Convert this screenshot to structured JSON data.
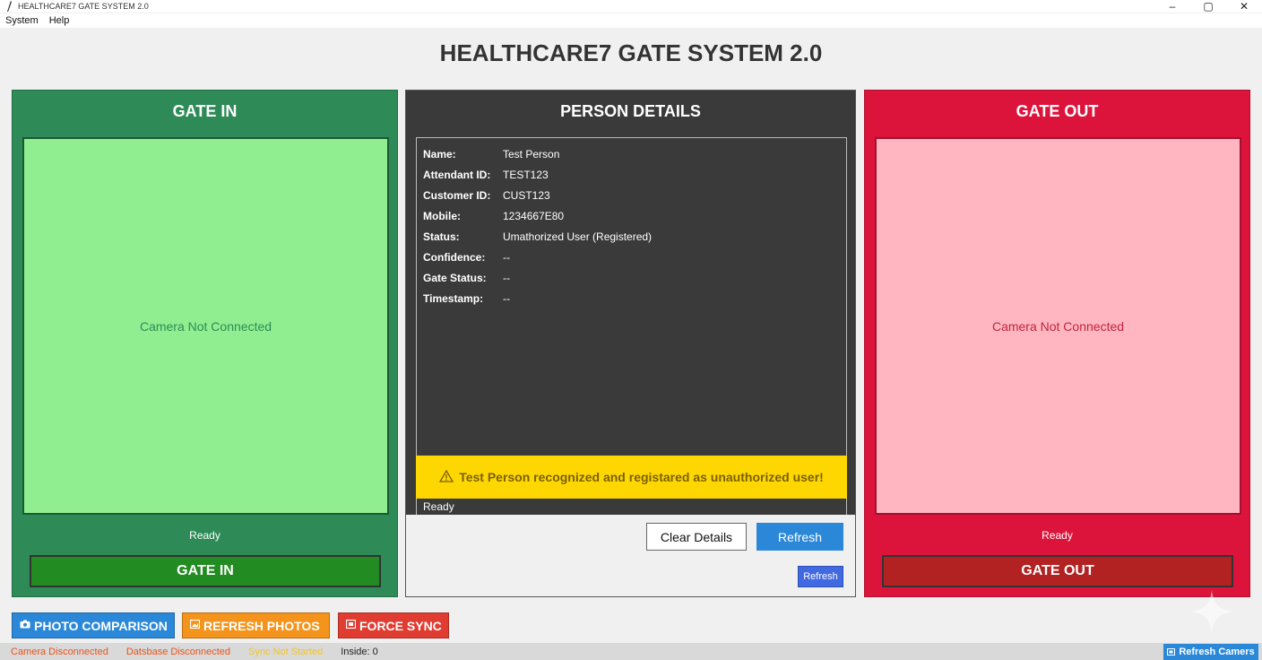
{
  "window": {
    "title": "HEALTHCARE7 GATE SYSTEM 2.0",
    "minimize": "–",
    "maximize": "▢",
    "close": "✕"
  },
  "menu": {
    "items": [
      "System",
      "Help"
    ]
  },
  "app_title": "HEALTHCARE7 GATE SYSTEM 2.0",
  "gate_in": {
    "title": "GATE IN",
    "camera_text": "Camera Not Connected",
    "status": "Ready",
    "button": "GATE IN"
  },
  "gate_out": {
    "title": "GATE OUT",
    "camera_text": "Camera Not Connected",
    "status": "Ready",
    "button": "GATE OUT"
  },
  "person": {
    "title": "PERSON DETAILS",
    "fields": [
      {
        "label": "Name:",
        "value": "Test Person"
      },
      {
        "label": "Attendant ID:",
        "value": "TEST123"
      },
      {
        "label": "Customer ID:",
        "value": "CUST123"
      },
      {
        "label": "Mobile:",
        "value": "1234667E80"
      },
      {
        "label": "Status:",
        "value": "Umathorized User (Registered)"
      },
      {
        "label": "Confidence:",
        "value": "--"
      },
      {
        "label": "Gate Status:",
        "value": "--"
      },
      {
        "label": "Timestamp:",
        "value": "--"
      }
    ],
    "alert": "Test Person recognized and registared as unauthorized user!",
    "status_line": "Ready",
    "clear_button": "Clear Details",
    "refresh_button": "Refresh",
    "refresh_small_button": "Refresh"
  },
  "actions": {
    "photo_comparison": "PHOTO COMPARISON",
    "refresh_photos": "REFRESH PHOTOS",
    "force_sync": "FORCE SYNC"
  },
  "statusbar": {
    "camera": "Camera Disconnected",
    "database": "Datsbase Disconnected",
    "sync": "Sync Not Started",
    "inside": "Inside: 0",
    "refresh_cameras": "Refresh Camers"
  },
  "colors": {
    "gate_in": "#2e8b57",
    "gate_out": "#dc143c",
    "person_bg": "#3a3a3a",
    "alert": "#ffd700",
    "accent_blue": "#2b88d8",
    "orange": "#f4941c",
    "red_btn": "#e03c31",
    "status_camera": "#e8541c",
    "status_database": "#e8541c",
    "status_sync": "#f3c623"
  },
  "icons": {
    "app": "feather-icon",
    "photo_comparison": "camera-icon",
    "refresh_photos": "image-icon",
    "force_sync": "sync-icon",
    "refresh_cameras": "camera-icon",
    "alert": "warning-triangle-icon"
  }
}
